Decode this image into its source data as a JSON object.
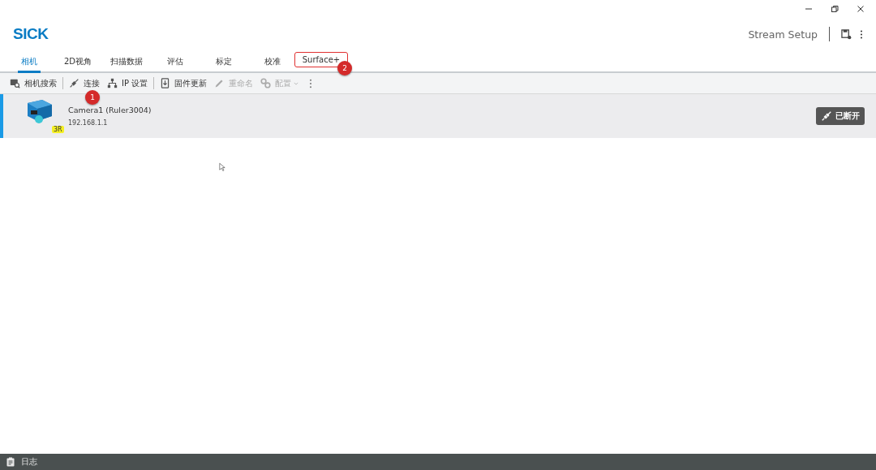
{
  "header": {
    "logo": "SICK",
    "app_title": "Stream Setup"
  },
  "tabs": [
    {
      "label": "相机",
      "selected": true,
      "annotated": false
    },
    {
      "label": "2D视角",
      "selected": false,
      "annotated": false
    },
    {
      "label": "扫描数据",
      "selected": false,
      "annotated": false
    },
    {
      "label": "评估",
      "selected": false,
      "annotated": false
    },
    {
      "label": "标定",
      "selected": false,
      "annotated": false
    },
    {
      "label": "校准",
      "selected": false,
      "annotated": false
    },
    {
      "label": "Surface+",
      "selected": false,
      "annotated": true,
      "marker": "2"
    }
  ],
  "toolbar": [
    {
      "kind": "button",
      "label": "相机搜索",
      "disabled": false
    },
    {
      "kind": "separator"
    },
    {
      "kind": "button",
      "label": "连接",
      "disabled": false,
      "marker": "1"
    },
    {
      "kind": "button",
      "label": "IP 设置",
      "disabled": false
    },
    {
      "kind": "separator"
    },
    {
      "kind": "button",
      "label": "固件更新",
      "disabled": false
    },
    {
      "kind": "button",
      "label": "重命名",
      "disabled": true
    },
    {
      "kind": "dropdown",
      "label": "配置",
      "disabled": true
    },
    {
      "kind": "more"
    }
  ],
  "devices": [
    {
      "name": "Camera1 (Ruler3004)",
      "ip": "192.168.1.1",
      "badge": "3R",
      "selected": true,
      "status": "已断开"
    }
  ],
  "status_bar": {
    "label": "日志"
  }
}
